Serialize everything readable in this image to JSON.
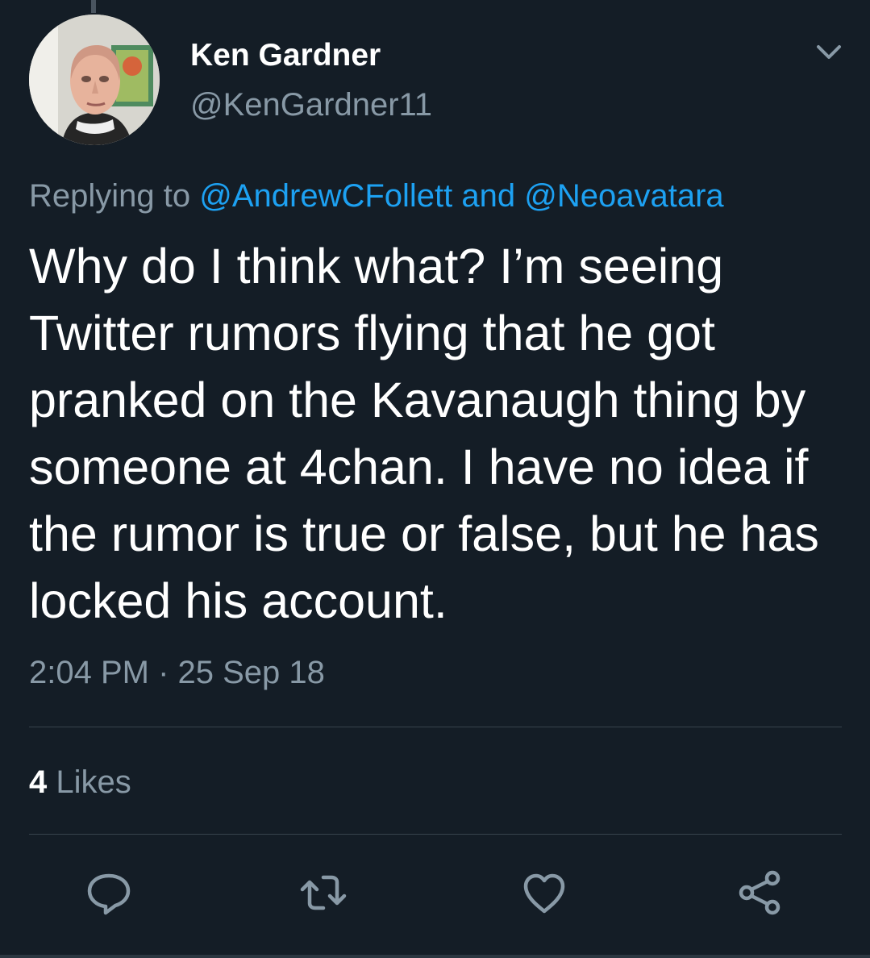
{
  "tweet": {
    "author_name": "Ken Gardner",
    "author_handle": "@KenGardner11",
    "reply_prefix": "Replying to ",
    "reply_mention_1": "@AndrewCFollett",
    "reply_joiner": " and ",
    "reply_mention_2": "@Neoavatara",
    "text": "Why do I think what? I’m seeing Twitter rumors flying that he got pranked on the Kavanaugh thing by someone at 4chan. I have no idea if the rumor is true or false, but he has locked his account.",
    "timestamp": "2:04 PM · 25 Sep 18",
    "likes_count": "4",
    "likes_label": " Likes"
  },
  "icons": {
    "menu": "chevron-down-icon",
    "reply": "reply-icon",
    "retweet": "retweet-icon",
    "like": "heart-icon",
    "share": "share-icon"
  },
  "colors": {
    "background": "#141d26",
    "primary_text": "#ffffff",
    "secondary_text": "#8899a6",
    "link": "#1da1f2",
    "divider": "#38444d"
  }
}
